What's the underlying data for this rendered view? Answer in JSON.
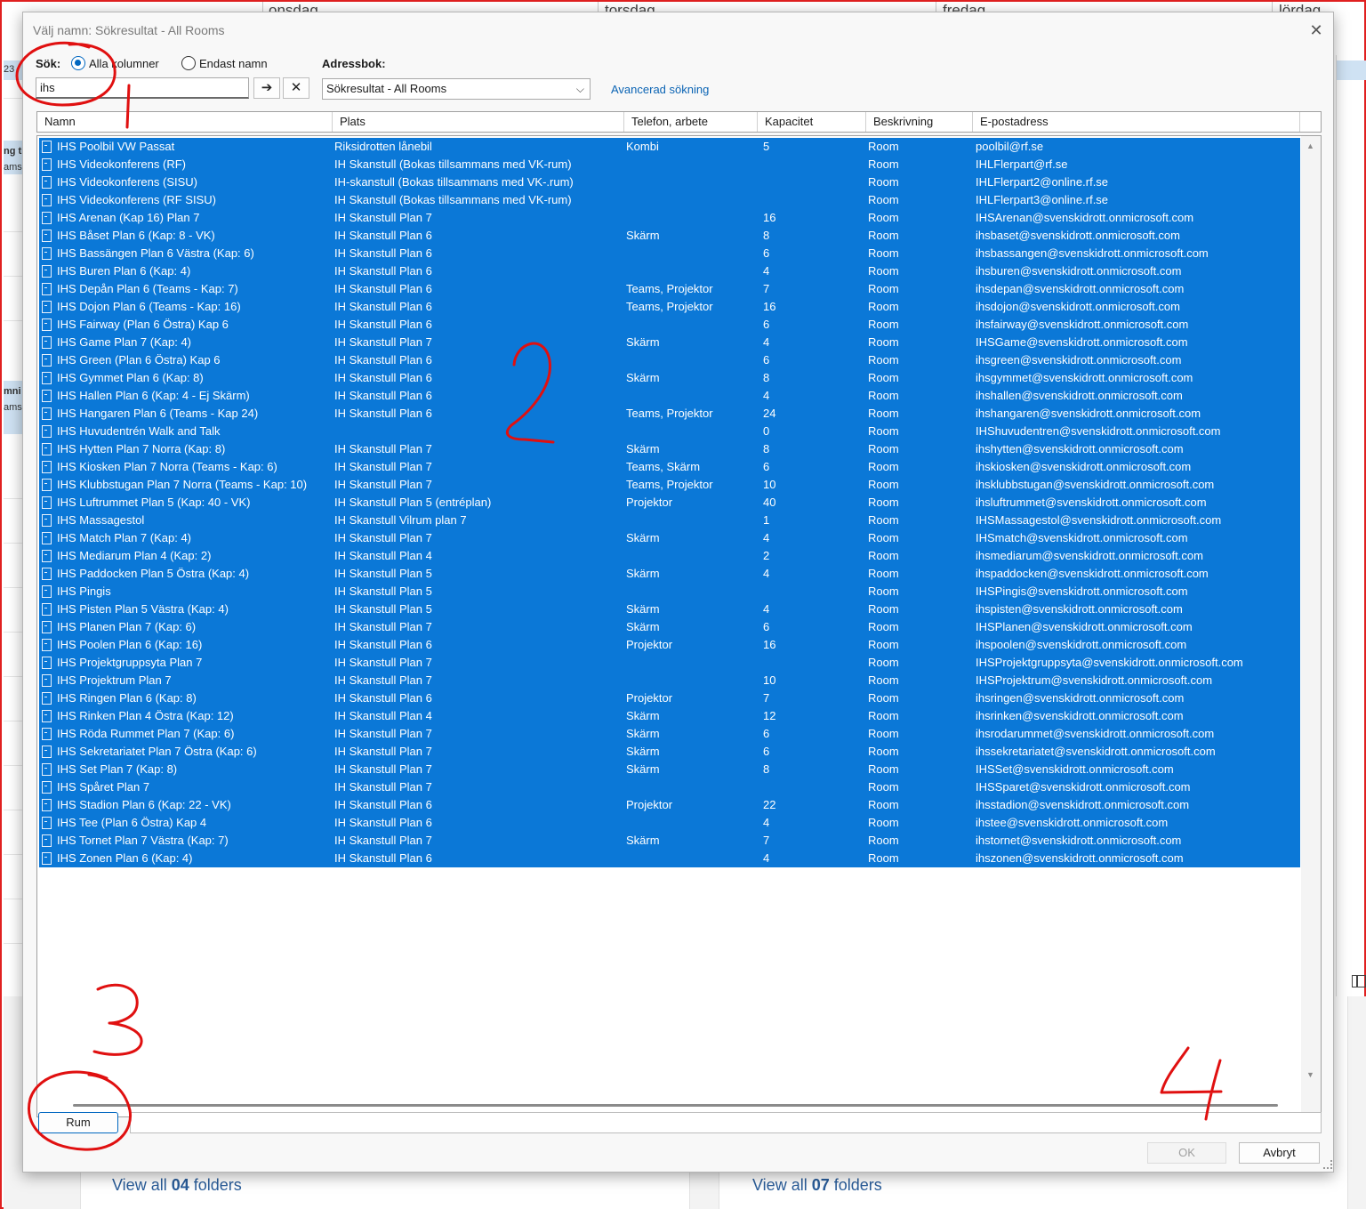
{
  "background": {
    "days": [
      "onsdag",
      "torsdag",
      "fredag",
      "lördag"
    ],
    "left_labels": [
      "23",
      "ng ti",
      "ams",
      "mni",
      "ams"
    ],
    "view_all_left": {
      "prefix": "View all ",
      "count": "04",
      "suffix": " folders"
    },
    "view_all_right": {
      "prefix": "View all ",
      "count": "07",
      "suffix": " folders"
    }
  },
  "dialog": {
    "title": "Välj namn: Sökresultat - All Rooms",
    "close_icon": "close-icon",
    "search": {
      "label": "Sök:",
      "options": [
        "Alla kolumner",
        "Endast namn"
      ],
      "selected": "Alla kolumner",
      "value": "ihs",
      "go_icon": "arrow-right-icon",
      "clear_icon": "clear-icon"
    },
    "address_book": {
      "label": "Adressbok:",
      "value": "Sökresultat - All Rooms"
    },
    "advanced_link": "Avancerad sökning",
    "columns": [
      "Namn",
      "Plats",
      "Telefon, arbete",
      "Kapacitet",
      "Beskrivning",
      "E-postadress"
    ],
    "rows": [
      [
        "IHS Poolbil VW Passat",
        "Riksidrotten lånebil",
        "Kombi",
        "5",
        "Room",
        "poolbil@rf.se"
      ],
      [
        "IHS Videokonferens (RF)",
        "IH Skanstull (Bokas tillsammans med VK-rum)",
        "",
        "",
        "Room",
        "IHLFlerpart@rf.se"
      ],
      [
        "IHS Videokonferens (SISU)",
        "IH-skanstull (Bokas tillsammans med VK-.rum)",
        "",
        "",
        "Room",
        "IHLFlerpart2@online.rf.se"
      ],
      [
        "IHS Videokonferens (RF SISU)",
        "IH Skanstull (Bokas tillsammans med VK-rum)",
        "",
        "",
        "Room",
        "IHLFlerpart3@online.rf.se"
      ],
      [
        "IHS Arenan (Kap 16) Plan 7",
        "IH Skanstull Plan 7",
        "",
        "16",
        "Room",
        "IHSArenan@svenskidrott.onmicrosoft.com"
      ],
      [
        "IHS Båset Plan 6 (Kap: 8 - VK)",
        "IH Skanstull Plan 6",
        "Skärm",
        "8",
        "Room",
        "ihsbaset@svenskidrott.onmicrosoft.com"
      ],
      [
        "IHS Bassängen Plan 6 Västra (Kap: 6)",
        "IH Skanstull Plan 6",
        "",
        "6",
        "Room",
        "ihsbassangen@svenskidrott.onmicrosoft.com"
      ],
      [
        "IHS Buren Plan 6 (Kap: 4)",
        "IH Skanstull Plan 6",
        "",
        "4",
        "Room",
        "ihsburen@svenskidrott.onmicrosoft.com"
      ],
      [
        "IHS Depån Plan 6 (Teams - Kap: 7)",
        "IH Skanstull Plan 6",
        "Teams, Projektor",
        "7",
        "Room",
        "ihsdepan@svenskidrott.onmicrosoft.com"
      ],
      [
        "IHS Dojon Plan 6 (Teams - Kap: 16)",
        "IH Skanstull Plan 6",
        "Teams, Projektor",
        "16",
        "Room",
        "ihsdojon@svenskidrott.onmicrosoft.com"
      ],
      [
        "IHS Fairway (Plan 6 Östra) Kap 6",
        "IH Skanstull Plan 6",
        "",
        "6",
        "Room",
        "ihsfairway@svenskidrott.onmicrosoft.com"
      ],
      [
        "IHS Game Plan 7 (Kap: 4)",
        "IH Skanstull Plan 7",
        "Skärm",
        "4",
        "Room",
        "IHSGame@svenskidrott.onmicrosoft.com"
      ],
      [
        "IHS Green (Plan 6 Östra) Kap 6",
        "IH Skanstull Plan 6",
        "",
        "6",
        "Room",
        "ihsgreen@svenskidrott.onmicrosoft.com"
      ],
      [
        "IHS Gymmet Plan 6  (Kap: 8)",
        "IH Skanstull Plan 6",
        "Skärm",
        "8",
        "Room",
        "ihsgymmet@svenskidrott.onmicrosoft.com"
      ],
      [
        "IHS Hallen Plan 6 (Kap: 4 - Ej Skärm)",
        "IH Skanstull Plan 6",
        "",
        "4",
        "Room",
        "ihshallen@svenskidrott.onmicrosoft.com"
      ],
      [
        "IHS Hangaren Plan 6 (Teams - Kap 24)",
        "IH Skanstull Plan 6",
        "Teams, Projektor",
        "24",
        "Room",
        "ihshangaren@svenskidrott.onmicrosoft.com"
      ],
      [
        "IHS Huvudentrén Walk and Talk",
        "",
        "",
        "0",
        "Room",
        "IHShuvudentren@svenskidrott.onmicrosoft.com"
      ],
      [
        "IHS Hytten Plan 7 Norra (Kap: 8)",
        "IH Skanstull Plan 7",
        "Skärm",
        "8",
        "Room",
        "ihshytten@svenskidrott.onmicrosoft.com"
      ],
      [
        "IHS Kiosken Plan 7 Norra (Teams - Kap: 6)",
        "IH Skanstull Plan 7",
        "Teams, Skärm",
        "6",
        "Room",
        "ihskiosken@svenskidrott.onmicrosoft.com"
      ],
      [
        "IHS Klubbstugan Plan 7 Norra (Teams - Kap: 10)",
        "IH Skanstull Plan 7",
        "Teams, Projektor",
        "10",
        "Room",
        "ihsklubbstugan@svenskidrott.onmicrosoft.com"
      ],
      [
        "IHS Luftrummet Plan 5 (Kap: 40 - VK)",
        "IH Skanstull Plan 5 (entréplan)",
        "Projektor",
        "40",
        "Room",
        "ihsluftrummet@svenskidrott.onmicrosoft.com"
      ],
      [
        "IHS Massagestol",
        "IH Skanstull Vilrum plan 7",
        "",
        "1",
        "Room",
        "IHSMassagestol@svenskidrott.onmicrosoft.com"
      ],
      [
        "IHS Match Plan 7 (Kap: 4)",
        "IH Skanstull Plan 7",
        "Skärm",
        "4",
        "Room",
        "IHSmatch@svenskidrott.onmicrosoft.com"
      ],
      [
        "IHS Mediarum Plan 4 (Kap: 2)",
        "IH Skanstull Plan 4",
        "",
        "2",
        "Room",
        "ihsmediarum@svenskidrott.onmicrosoft.com"
      ],
      [
        "IHS Paddocken Plan 5 Östra (Kap: 4)",
        "IH Skanstull Plan 5",
        "Skärm",
        "4",
        "Room",
        "ihspaddocken@svenskidrott.onmicrosoft.com"
      ],
      [
        "IHS Pingis",
        "IH Skanstull Plan 5",
        "",
        "",
        "Room",
        "IHSPingis@svenskidrott.onmicrosoft.com"
      ],
      [
        "IHS Pisten Plan 5 Västra (Kap: 4)",
        "IH Skanstull Plan 5",
        "Skärm",
        "4",
        "Room",
        "ihspisten@svenskidrott.onmicrosoft.com"
      ],
      [
        "IHS Planen Plan 7 (Kap: 6)",
        "IH Skanstull Plan 7",
        "Skärm",
        "6",
        "Room",
        "IHSPlanen@svenskidrott.onmicrosoft.com"
      ],
      [
        "IHS Poolen Plan 6 (Kap: 16)",
        "IH Skanstull Plan 6",
        "Projektor",
        "16",
        "Room",
        "ihspoolen@svenskidrott.onmicrosoft.com"
      ],
      [
        "IHS Projektgruppsyta Plan 7",
        "IH Skanstull Plan 7",
        "",
        "",
        "Room",
        "IHSProjektgruppsyta@svenskidrott.onmicrosoft.com"
      ],
      [
        "IHS Projektrum Plan 7",
        "IH Skanstull Plan 7",
        "",
        "10",
        "Room",
        "IHSProjektrum@svenskidrott.onmicrosoft.com"
      ],
      [
        "IHS Ringen Plan 6 (Kap: 8)",
        "IH Skanstull Plan 6",
        "Projektor",
        "7",
        "Room",
        "ihsringen@svenskidrott.onmicrosoft.com"
      ],
      [
        "IHS Rinken Plan 4 Östra (Kap: 12)",
        "IH Skanstull Plan 4",
        "Skärm",
        "12",
        "Room",
        "ihsrinken@svenskidrott.onmicrosoft.com"
      ],
      [
        "IHS Röda Rummet Plan 7 (Kap: 6)",
        "IH Skanstull Plan 7",
        "Skärm",
        "6",
        "Room",
        "ihsrodarummet@svenskidrott.onmicrosoft.com"
      ],
      [
        "IHS Sekretariatet Plan 7 Östra (Kap: 6)",
        "IH Skanstull Plan 7",
        "Skärm",
        "6",
        "Room",
        "ihssekretariatet@svenskidrott.onmicrosoft.com"
      ],
      [
        "IHS Set Plan 7 (Kap: 8)",
        "IH Skanstull Plan 7",
        "Skärm",
        "8",
        "Room",
        "IHSSet@svenskidrott.onmicrosoft.com"
      ],
      [
        "IHS Spåret Plan 7",
        "IH Skanstull Plan 7",
        "",
        "",
        "Room",
        "IHSSparet@svenskidrott.onmicrosoft.com"
      ],
      [
        "IHS Stadion Plan 6 (Kap: 22 - VK)",
        "IH Skanstull Plan 6",
        "Projektor",
        "22",
        "Room",
        "ihsstadion@svenskidrott.onmicrosoft.com"
      ],
      [
        "IHS Tee (Plan 6 Östra) Kap 4",
        "IH Skanstull Plan 6",
        "",
        "4",
        "Room",
        "ihstee@svenskidrott.onmicrosoft.com"
      ],
      [
        "IHS Tornet Plan 7 Västra (Kap: 7)",
        "IH Skanstull Plan 7",
        "Skärm",
        "7",
        "Room",
        "ihstornet@svenskidrott.onmicrosoft.com"
      ],
      [
        "IHS Zonen Plan 6 (Kap: 4)",
        "IH Skanstull Plan 6",
        "",
        "4",
        "Room",
        "ihszonen@svenskidrott.onmicrosoft.com"
      ]
    ],
    "rum_button": "Rum",
    "rum_value": "",
    "ok_label": "OK",
    "cancel_label": "Avbryt",
    "colors": {
      "selection": "#0b78d7",
      "accent": "#0067c0",
      "link": "#0b64b4"
    }
  },
  "annotations": {
    "color": "#e01010",
    "labels": [
      "1",
      "2",
      "3",
      "4"
    ]
  }
}
